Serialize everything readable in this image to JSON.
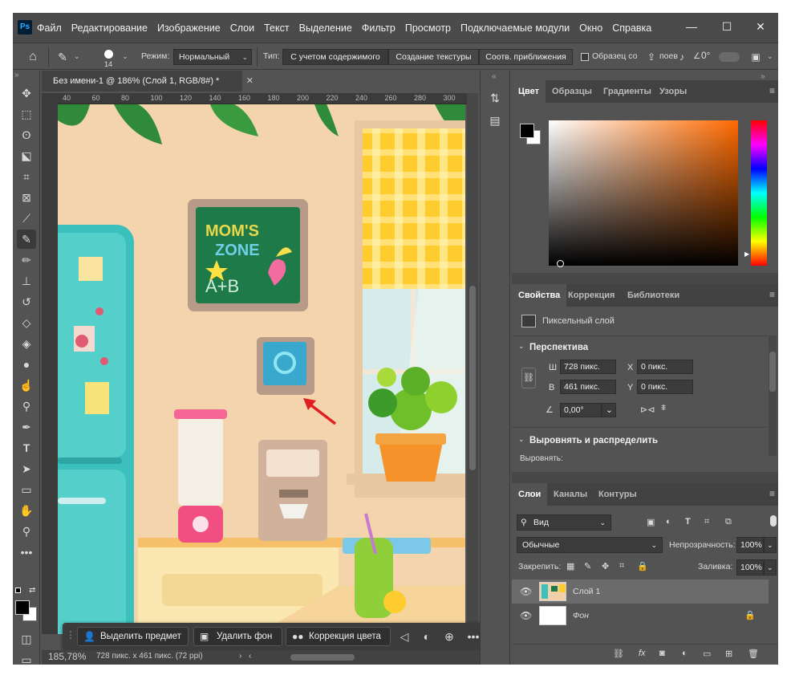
{
  "app": {
    "logo": "Ps"
  },
  "menu": [
    "Файл",
    "Редактирование",
    "Изображение",
    "Слои",
    "Текст",
    "Выделение",
    "Фильтр",
    "Просмотр",
    "Подключаемые модули",
    "Окно",
    "Справка"
  ],
  "window_controls": {
    "minimize": "—",
    "maximize": "☐",
    "close": "✕"
  },
  "options": {
    "brush_size": "14",
    "mode_label": "Режим:",
    "mode_value": "Нормальный",
    "type_label": "Тип:",
    "type_buttons": [
      "С учетом содержимого",
      "Создание текстуры",
      "Соотв. приближения"
    ],
    "sample_label": "Образец со в",
    "sample_checked": false,
    "extra1": "поев",
    "extra2": "0°"
  },
  "document": {
    "tab_title": "Без имени-1 @ 186% (Слой 1, RGB/8#) *",
    "ruler_ticks": [
      "40",
      "60",
      "80",
      "100",
      "120",
      "140",
      "160",
      "180",
      "200",
      "220",
      "240",
      "260",
      "280",
      "300"
    ],
    "zoom": "185,78%",
    "info": "728 пикс. x 461 пикс. (72 ppi)"
  },
  "canvas_art": {
    "sign_line1": "MOM'S",
    "sign_line2": "ZONE",
    "sign_extra": "A+B"
  },
  "context_bar": {
    "select_subject": "Выделить предмет",
    "remove_bg": "Удалить фон",
    "color_correction": "Коррекция цвета",
    "more": "•••"
  },
  "color_panel": {
    "tabs": [
      "Цвет",
      "Образцы",
      "Градиенты",
      "Узоры"
    ],
    "active": "Цвет",
    "fg": "#000000",
    "bg": "#ffffff",
    "hue": "#ff6a00"
  },
  "properties": {
    "tabs": [
      "Свойства",
      "Коррекция",
      "Библиотеки"
    ],
    "layer_type": "Пиксельный слой",
    "perspective_title": "Перспектива",
    "w_label": "Ш",
    "w_value": "728 пикс.",
    "h_label": "В",
    "h_value": "461 пикс.",
    "x_label": "X",
    "x_value": "0 пикс.",
    "y_label": "Y",
    "y_value": "0 пикс.",
    "angle_value": "0,00°",
    "align_title": "Выровнять и распределить",
    "align_label": "Выровнять:"
  },
  "layers": {
    "tabs": [
      "Слои",
      "Каналы",
      "Контуры"
    ],
    "filter_label": "Вид",
    "blend_mode": "Обычные",
    "opacity_label": "Непрозрачность:",
    "opacity_value": "100%",
    "lock_label": "Закрепить:",
    "fill_label": "Заливка:",
    "fill_value": "100%",
    "items": [
      {
        "name": "Слой 1",
        "selected": true
      },
      {
        "name": "Фон",
        "selected": false,
        "locked": true
      }
    ]
  },
  "tools": [
    "move-tool",
    "marquee-tool",
    "lasso-tool",
    "object-select-tool",
    "crop-tool",
    "frame-tool",
    "eyedropper-tool",
    "spot-healing-tool",
    "brush-tool",
    "stamp-tool",
    "history-brush-tool",
    "eraser-tool",
    "paint-bucket-tool",
    "blur-tool",
    "dodge-tool",
    "smudge-tool",
    "pen-tool",
    "type-tool",
    "path-select-tool",
    "rectangle-tool",
    "hand-tool",
    "zoom-tool",
    "more-tools"
  ]
}
